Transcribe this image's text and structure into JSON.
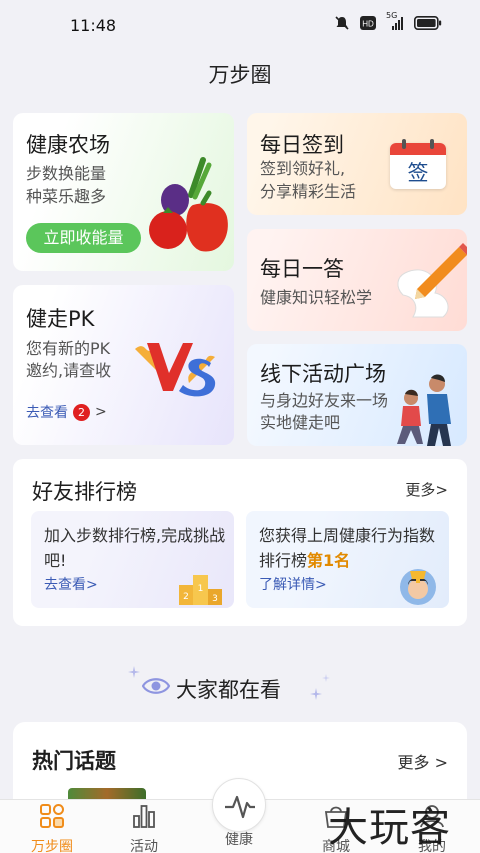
{
  "status": {
    "time": "11:48",
    "network": "5G"
  },
  "page_title": "万步圈",
  "cards": {
    "farm": {
      "title": "健康农场",
      "line1": "步数换能量",
      "line2": "种菜乐趣多",
      "button": "立即收能量"
    },
    "signin": {
      "title": "每日签到",
      "line1": "签到领好礼,",
      "line2": "分享精彩生活",
      "calendar_char": "签"
    },
    "answer": {
      "title": "每日一答",
      "line1": "健康知识轻松学"
    },
    "walk": {
      "title": "健走PK",
      "line1": "您有新的PK",
      "line2": "邀约,请查收",
      "link": "去查看",
      "badge": "2",
      "vs": "VS"
    },
    "offline": {
      "title": "线下活动广场",
      "line1": "与身边好友来一场",
      "line2": "实地健走吧"
    }
  },
  "rank": {
    "title": "好友排行榜",
    "more": "更多>",
    "left": {
      "text": "加入步数排行榜,完成挑战吧!",
      "link": "去查看>"
    },
    "right": {
      "text_before": "您获得上周健康行为指数排行榜",
      "highlight": "第1名",
      "link": "了解详情>"
    }
  },
  "watch_title": "大家都在看",
  "topics": {
    "title": "热门话题",
    "more": "更多 >"
  },
  "tabs": [
    {
      "label": "万步圈",
      "icon": "grid-icon",
      "active": true
    },
    {
      "label": "活动",
      "icon": "chart-icon",
      "active": false
    },
    {
      "label": "健康",
      "icon": "pulse-icon",
      "active": false
    },
    {
      "label": "商城",
      "icon": "shop-icon",
      "active": false
    },
    {
      "label": "我的",
      "icon": "person-icon",
      "active": false
    }
  ],
  "watermark": "大玩客",
  "colors": {
    "accent": "#f08c1a",
    "green": "#5bc65b",
    "link": "#3b5bb5",
    "badge": "#e02020"
  }
}
